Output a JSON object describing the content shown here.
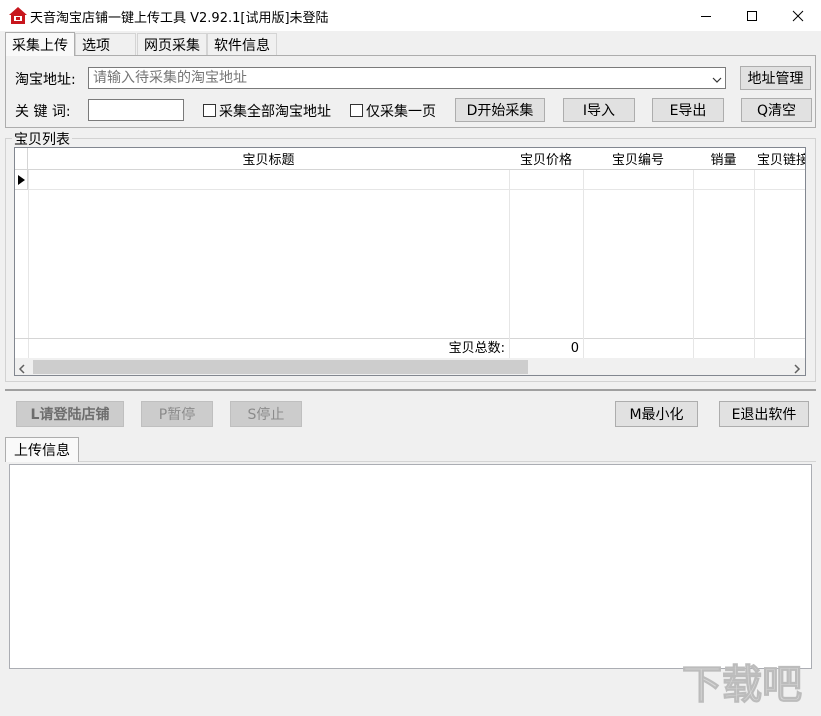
{
  "window": {
    "title": "天音淘宝店铺一键上传工具 V2.92.1[试用版]未登陆"
  },
  "tabs": [
    {
      "label": "采集上传"
    },
    {
      "label": "选项"
    },
    {
      "label": "网页采集"
    },
    {
      "label": "软件信息"
    }
  ],
  "collect": {
    "url_label": "淘宝地址:",
    "url_placeholder": "请输入待采集的淘宝地址",
    "address_manage_label": "地址管理",
    "keyword_label": "关 键 词:",
    "keyword_value": "",
    "collect_all_label": "采集全部淘宝地址",
    "collect_one_page_label": "仅采集一页",
    "start_label": "D开始采集",
    "import_label": "I导入",
    "export_label": "E导出",
    "clear_label": "Q清空"
  },
  "item_list": {
    "legend": "宝贝列表",
    "columns": [
      "宝贝标题",
      "宝贝价格",
      "宝贝编号",
      "销量",
      "宝贝链接"
    ],
    "total_label": "宝贝总数:",
    "total_value": "0"
  },
  "actions": {
    "login_label": "L请登陆店铺",
    "pause_label": "P暂停",
    "stop_label": "S停止",
    "minimize_label": "M最小化",
    "exit_label": "E退出软件"
  },
  "upload_info": {
    "tab_label": "上传信息",
    "log_text": ""
  },
  "watermark": {
    "text": "下载吧"
  },
  "colors": {
    "titlebar_bg": "#ffffff",
    "window_bg": "#f0f0f0",
    "icon_red": "#c8161d"
  }
}
